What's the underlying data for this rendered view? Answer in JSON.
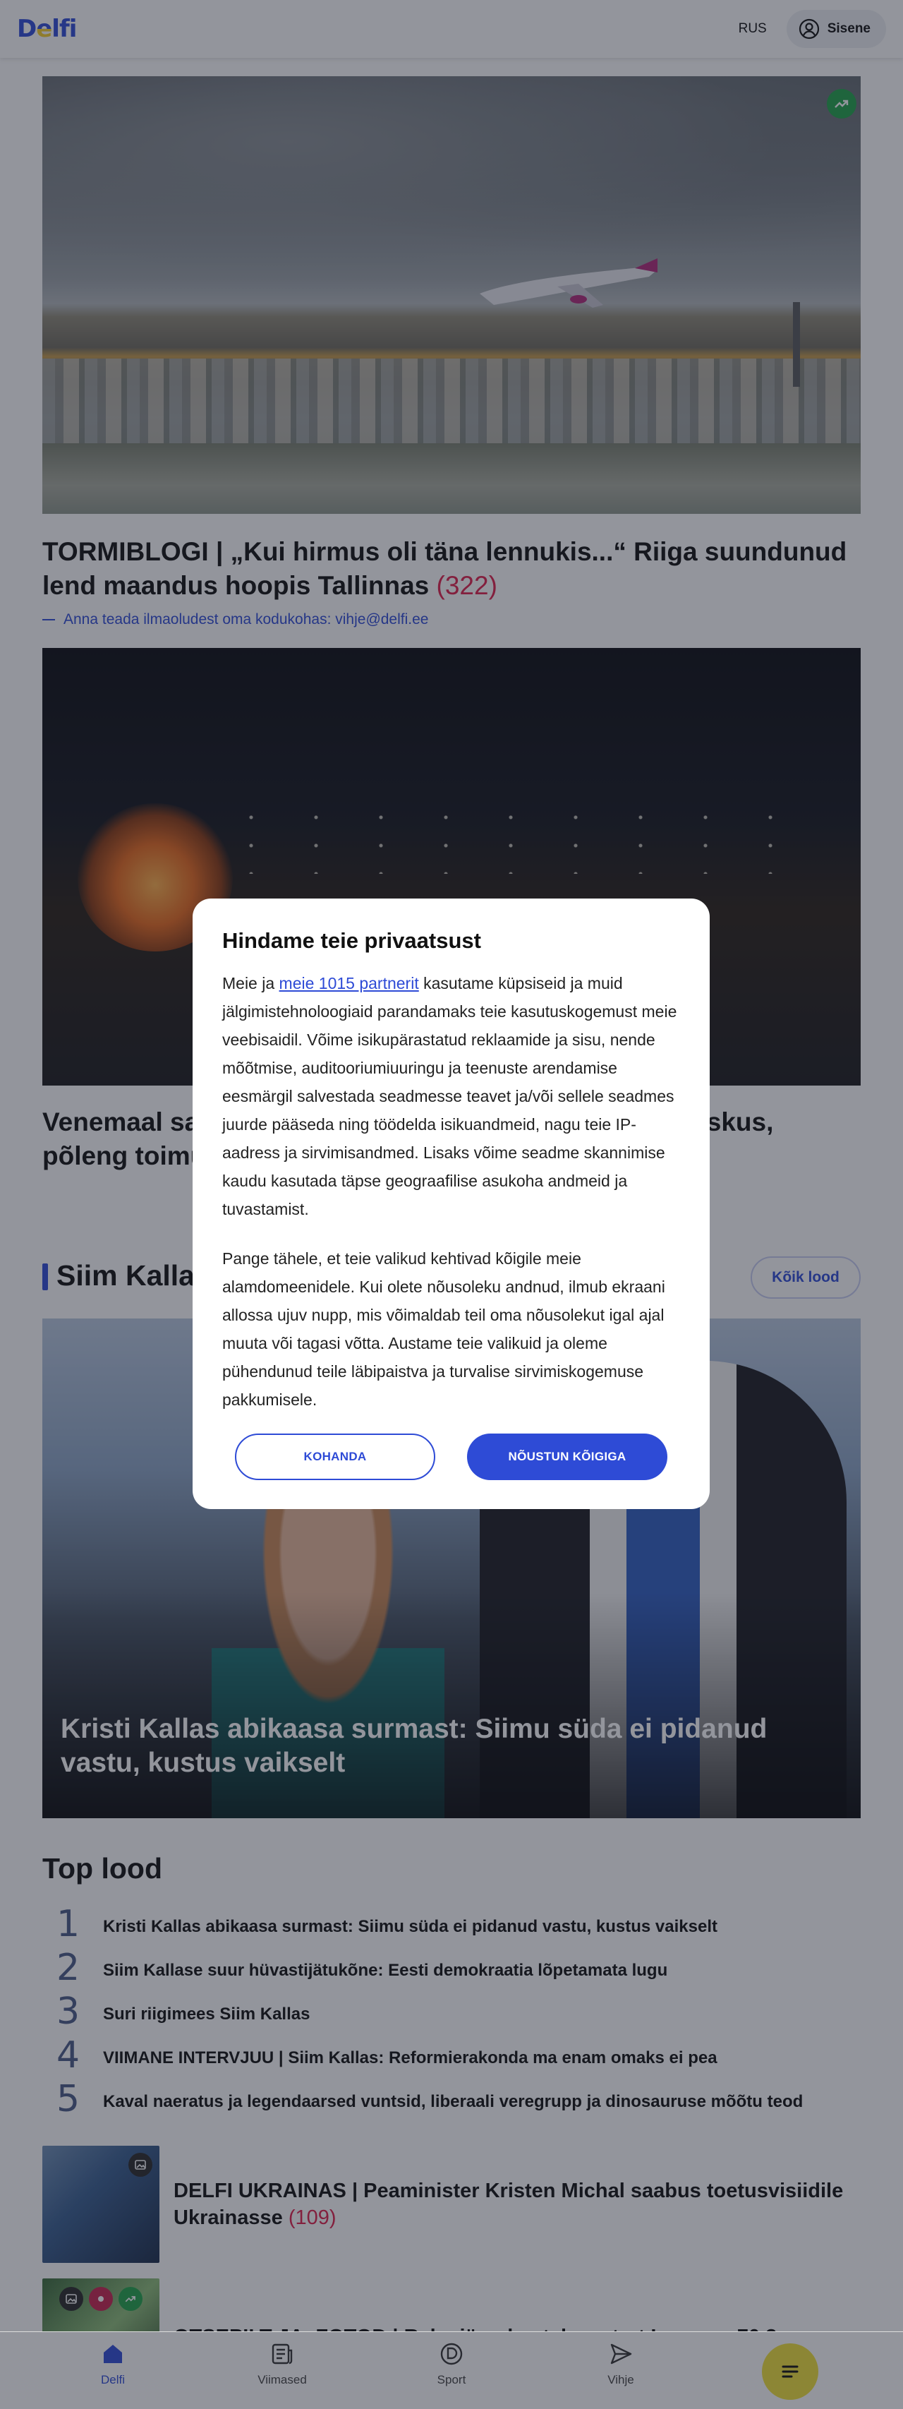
{
  "header": {
    "logo": "Delfi",
    "lang": "RUS",
    "signin_label": "Sisene"
  },
  "articles": [
    {
      "title": "TORMIBLOGI | „Kui hirmus oli täna lennukis...“ Riiga suundunud lend maandus hoopis Tallinnas",
      "comments": "(322)",
      "tip": "Anna teada ilmaoludest oma kodukohas: vihje@delfi.ee"
    },
    {
      "title": "Venemaal sa                                                                      skus, põleng toimu"
    }
  ],
  "section": {
    "title": "Siim Kalla",
    "all_label": "Kõik lood",
    "feature_caption": "Kristi Kallas abikaasa surmast: Siimu süda ei pidanud vastu, kustus vaikselt"
  },
  "top_stories": {
    "title": "Top lood",
    "items": [
      {
        "num": "1",
        "text": "Kristi Kallas abikaasa surmast: Siimu süda ei pidanud vastu, kustus vaikselt"
      },
      {
        "num": "2",
        "text": "Siim Kallase suur hüvastijätukõne: Eesti demokraatia lõpetamata lugu"
      },
      {
        "num": "3",
        "text": "Suri riigimees Siim Kallas"
      },
      {
        "num": "4",
        "text": "VIIMANE INTERVJUU | Siim Kallas: Reformierakonda ma enam omaks ei pea"
      },
      {
        "num": "5",
        "text": "Kaval naeratus ja legendaarsed vuntsid, liberaali veregrupp ja dinosauruse mõõtu teod"
      }
    ]
  },
  "cards": [
    {
      "title": "DELFI UKRAINAS | Peaminister Kristen Michal saabus toetusvisiidile Ukrainasse",
      "comments": "(109)"
    },
    {
      "title": "OTSEPILT JA -FOTOD | Raku järvel antakse start Ironman 70.3"
    }
  ],
  "modal": {
    "title": "Hindame teie privaatsust",
    "p1_before": "Meie ja ",
    "p1_link": "meie 1015 partnerit",
    "p1_after": " kasutame küpsiseid ja muid jälgimistehnoloogiaid parandamaks teie kasutuskogemust meie veebisaidil. Võime isikupärastatud reklaamide ja sisu, nende mõõtmise, auditooriumiuuringu ja teenuste arendamise eesmärgil salvestada seadmesse teavet ja/või sellele seadmes juurde pääseda ning töödelda isikuandmeid, nagu teie IP-aadress ja sirvimisandmed. Lisaks võime seadme skannimise kaudu kasutada täpse geograafilise asukoha andmeid ja tuvastamist.",
    "p2": "Pange tähele, et teie valikud kehtivad kõigile meie alamdomeenidele. Kui olete nõusoleku andnud, ilmub ekraani allossa ujuv nupp, mis võimaldab teil oma nõusolekut igal ajal muuta või tagasi võtta. Austame teie valikuid ja oleme pühendunud teile läbipaistva ja turvalise sirvimiskogemuse pakkumisele.",
    "customize_label": "KOHANDA",
    "accept_label": "NÕUSTUN KÕIGIGA"
  },
  "bottom_nav": {
    "items": [
      {
        "label": "Delfi"
      },
      {
        "label": "Viimased"
      },
      {
        "label": "Sport"
      },
      {
        "label": "Vihje"
      }
    ]
  },
  "colors": {
    "brand": "#2e4bd6",
    "comments": "#e0204b",
    "trend": "#21a34a",
    "menu": "#f2e33a"
  }
}
